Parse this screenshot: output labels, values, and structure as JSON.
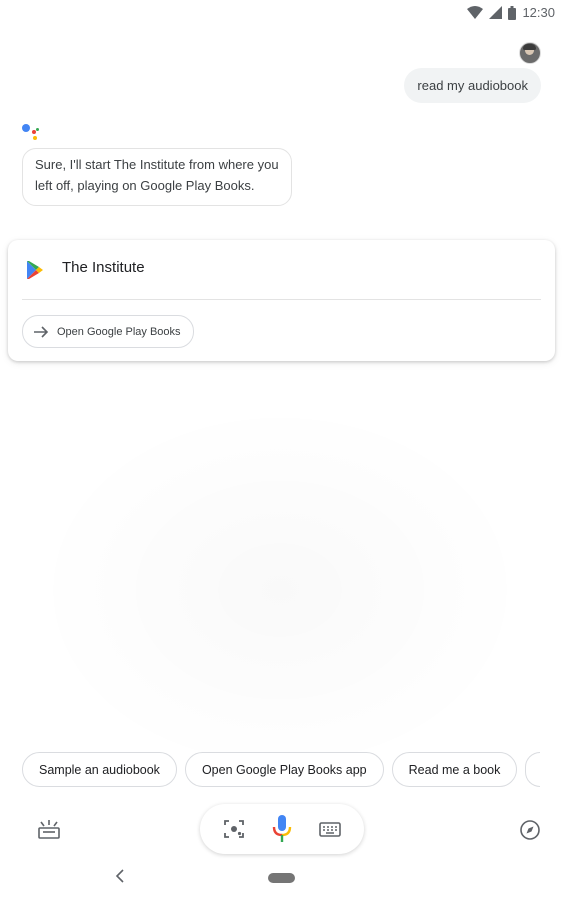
{
  "status_bar": {
    "time": "12:30",
    "icons": [
      "wifi-icon",
      "signal-icon",
      "battery-icon"
    ]
  },
  "conversation": {
    "user_query": "read my audiobook",
    "assistant_reply": "Sure, I'll start The Institute from where you left off, playing on Google Play Books."
  },
  "card": {
    "title": "The Institute",
    "action_label": "Open Google Play Books",
    "action_icon": "arrow-right-icon"
  },
  "suggestion_chips": [
    {
      "label": "Sample an audiobook"
    },
    {
      "label": "Open Google Play Books app"
    },
    {
      "label": "Read me a book"
    }
  ],
  "bottom_bar": {
    "left_icon": "updates-icon",
    "center_icons": [
      "lens-icon",
      "mic-icon",
      "keyboard-icon"
    ],
    "right_icon": "explore-icon"
  },
  "colors": {
    "google_blue": "#4285F4",
    "google_red": "#EA4335",
    "google_yellow": "#FBBC05",
    "google_green": "#34A853"
  }
}
